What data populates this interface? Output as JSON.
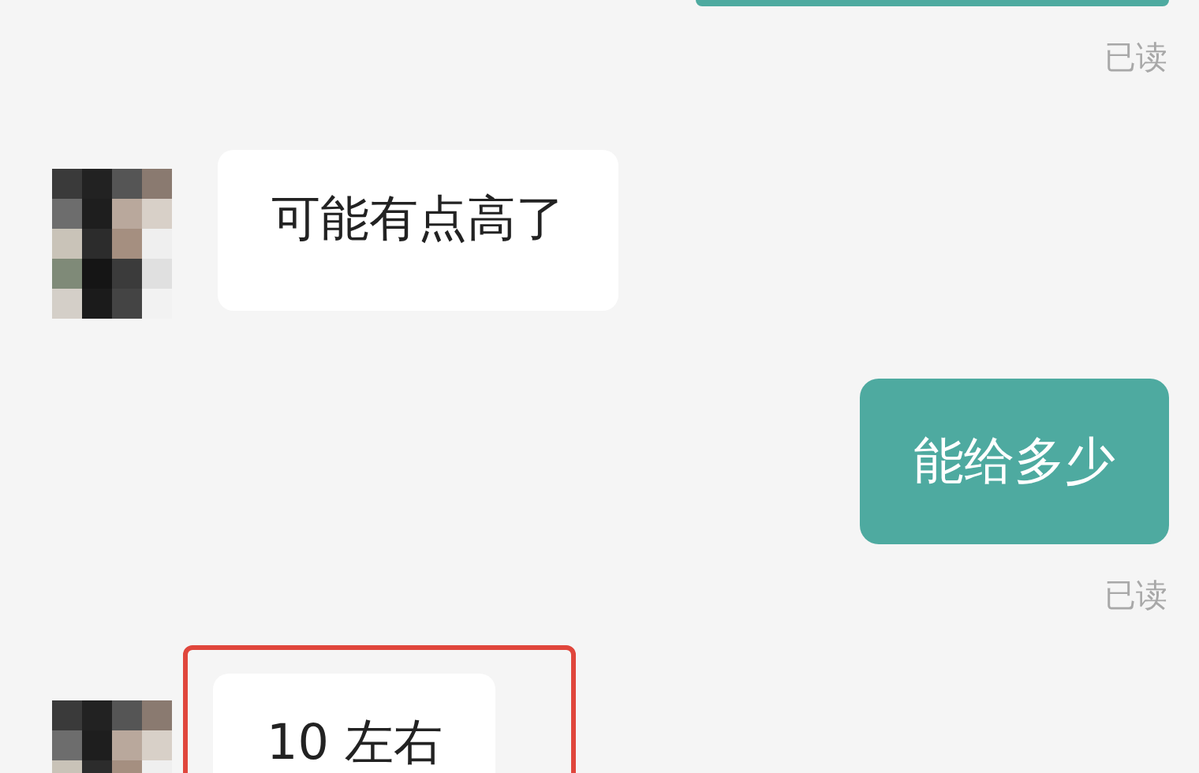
{
  "messages": [
    {
      "kind": "outgoing",
      "read_status": "已读"
    },
    {
      "kind": "incoming",
      "text": "可能有点高了"
    },
    {
      "kind": "outgoing",
      "text": "能给多少",
      "read_status": "已读"
    },
    {
      "kind": "incoming",
      "text": "10 左右",
      "highlighted": true
    }
  ]
}
